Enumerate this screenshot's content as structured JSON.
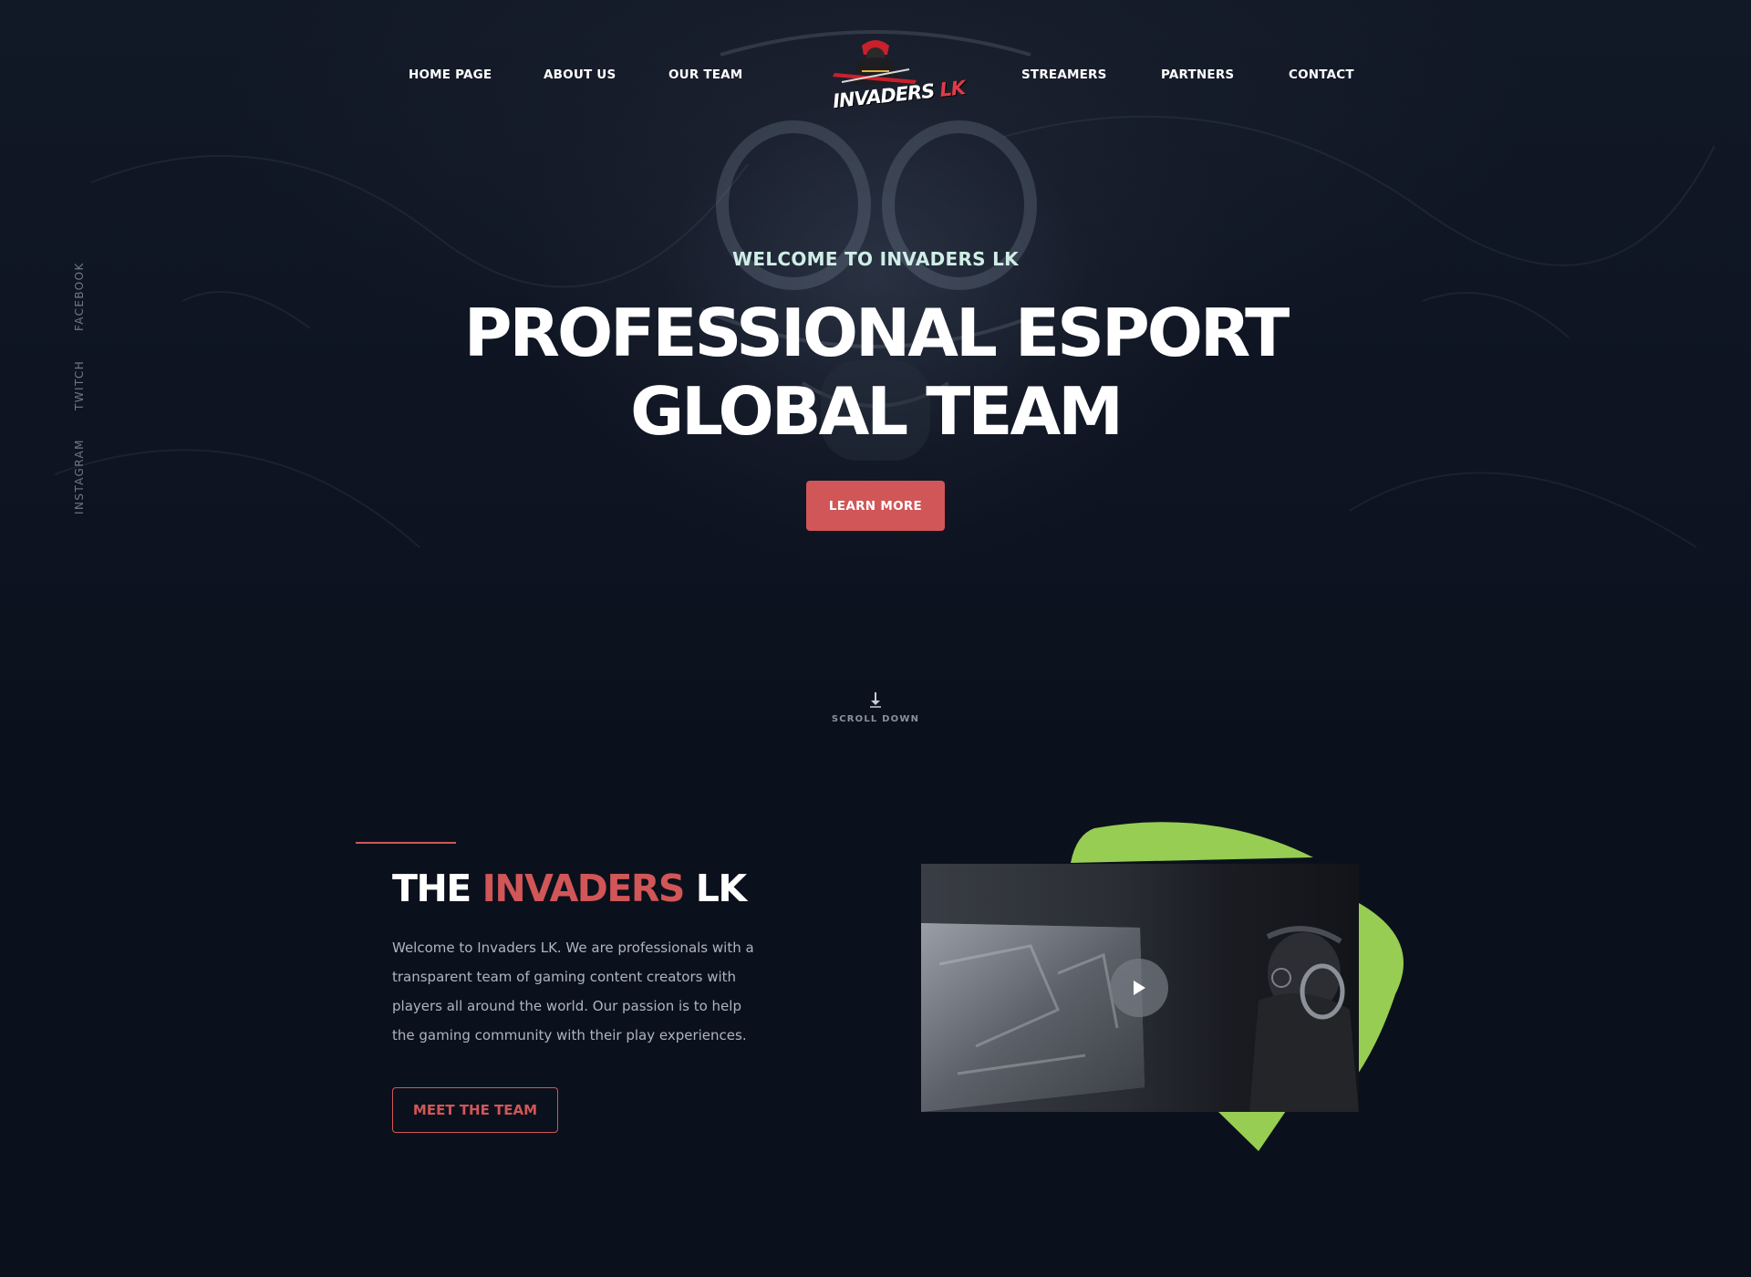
{
  "nav": {
    "left": [
      "HOME PAGE",
      "ABOUT US",
      "OUR TEAM"
    ],
    "right": [
      "STREAMERS",
      "PARTNERS",
      "CONTACT"
    ]
  },
  "logo": {
    "text_main": "INVADERS",
    "text_accent": "LK"
  },
  "social": [
    "FACEBOOK",
    "TWITCH",
    "INSTAGRAM"
  ],
  "hero": {
    "welcome": "WELCOME TO INVADERS LK",
    "headline_line1": "PROFESSIONAL ESPORT",
    "headline_line2": "GLOBAL TEAM",
    "cta": "LEARN MORE",
    "scroll_label": "SCROLL DOWN"
  },
  "about": {
    "title_prefix": "THE ",
    "title_highlight": "INVADERS",
    "title_suffix": " LK",
    "description": "Welcome to Invaders LK. We are professionals with a transparent team of gaming content creators with players all around the world. Our passion is to help the gaming community with their play experiences.",
    "cta": "MEET THE TEAM"
  },
  "colors": {
    "background": "#0b111c",
    "accent_red": "#d15658",
    "accent_green": "#97cd53",
    "welcome_text": "#cfeee6"
  },
  "icons": {
    "scroll": "arrow-down-icon",
    "play": "play-icon",
    "logo": "samurai-mascot-icon"
  }
}
